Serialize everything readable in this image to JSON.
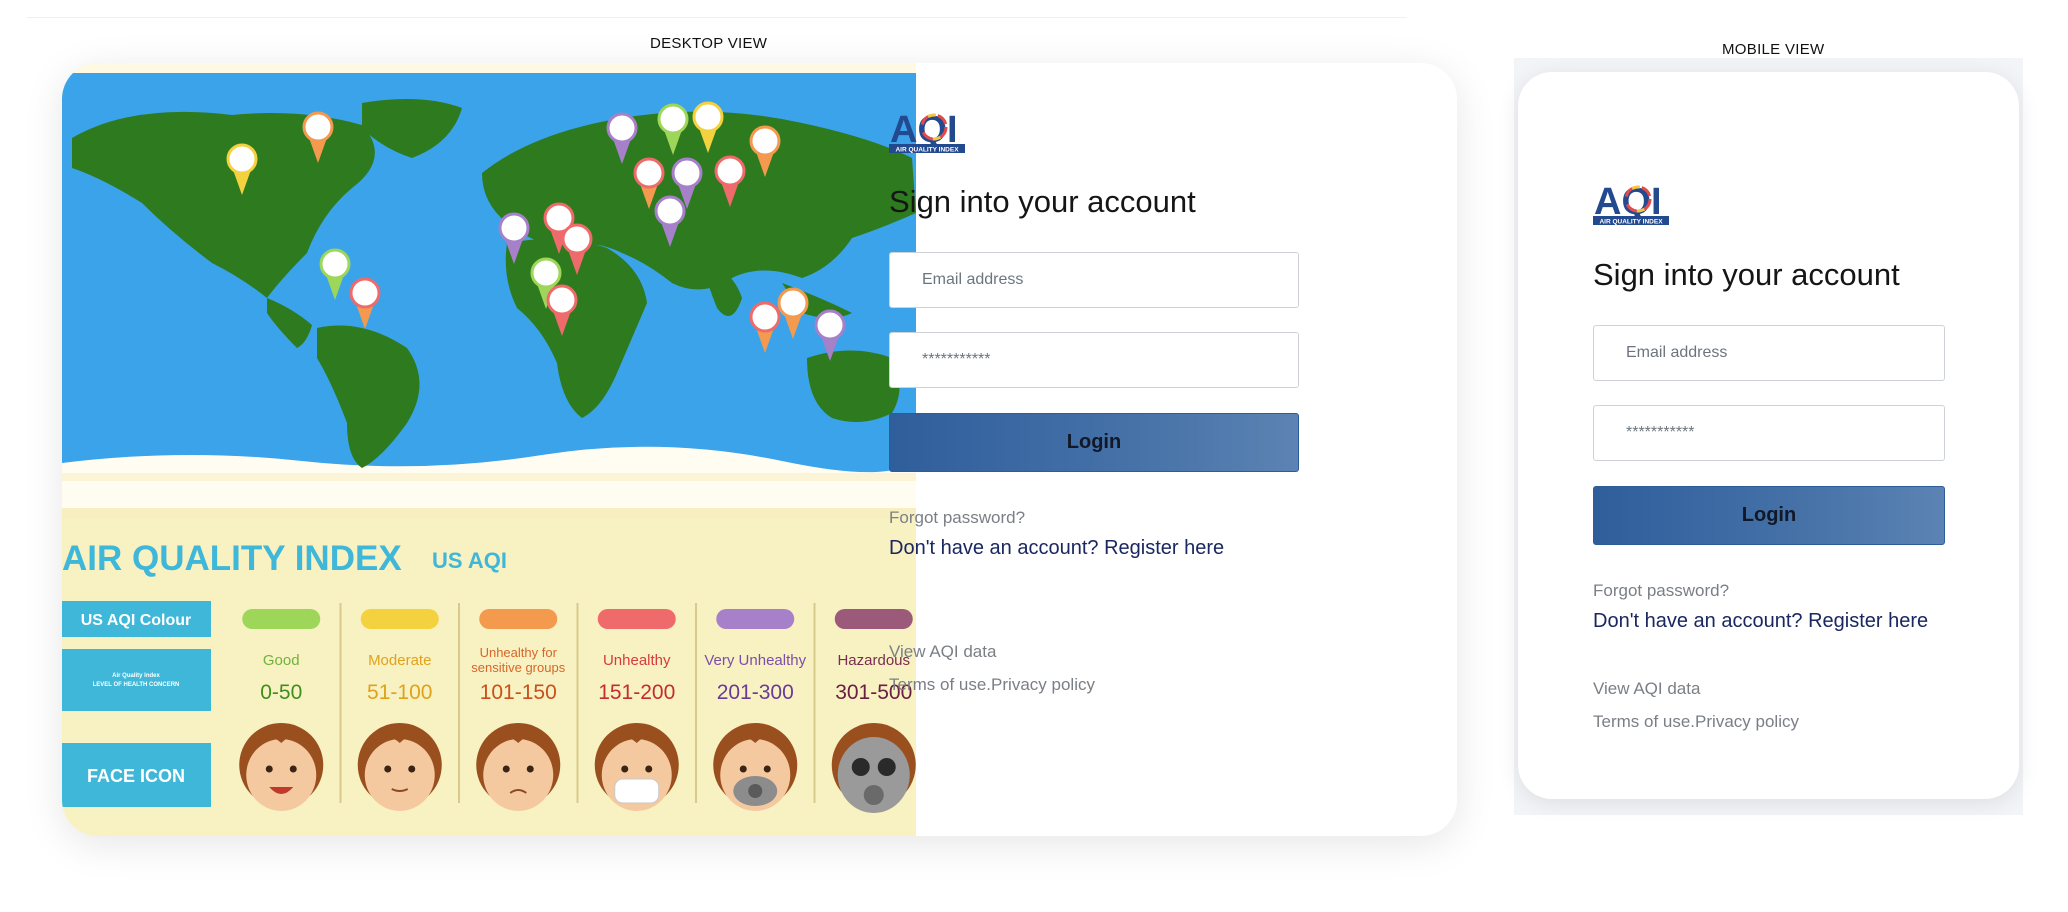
{
  "labels": {
    "desktop": "DESKTOP VIEW",
    "mobile": "MOBILE VIEW"
  },
  "brand": {
    "logo_text": "AQI",
    "logo_sub": "AIR QUALITY INDEX"
  },
  "login": {
    "heading": "Sign into your account",
    "email_placeholder": "Email address",
    "password_placeholder": "***********",
    "login_label": "Login",
    "forgot": "Forgot password?",
    "register": "Don't have an account? Register here",
    "view_data": "View AQI data",
    "terms": "Terms of use.",
    "privacy": "Privacy policy"
  },
  "hero": {
    "title": "AIR QUALITY INDEX",
    "title_suffix": "US AQI",
    "row_colour": "US AQI Colour",
    "row_level_1": "Air Quality Index",
    "row_level_2": "LEVEL OF HEALTH CONCERN",
    "row_face": "FACE ICON",
    "levels": [
      {
        "name": "Good",
        "range": "0-50",
        "color": "#9ed65a",
        "name_color": "#6fb33a",
        "range_color": "#3f8f1d"
      },
      {
        "name": "Moderate",
        "range": "51-100",
        "color": "#f4d23f",
        "name_color": "#e0a21b",
        "range_color": "#e0a21b"
      },
      {
        "name": "Unhealthy for sensitive groups",
        "range": "101-150",
        "color": "#f39a4e",
        "name_color": "#d6662a",
        "range_color": "#c8501c"
      },
      {
        "name": "Unhealthy",
        "range": "151-200",
        "color": "#ef6a6a",
        "name_color": "#d83b3b",
        "range_color": "#c52d2d"
      },
      {
        "name": "Very Unhealthy",
        "range": "201-300",
        "color": "#a680c9",
        "name_color": "#7c4ea8",
        "range_color": "#6a3b96"
      },
      {
        "name": "Hazardous",
        "range": "301-500",
        "color": "#9c5a7a",
        "name_color": "#7a2e50",
        "range_color": "#6a2042"
      }
    ]
  },
  "colors": {
    "accent": "#2f5e9c",
    "register_text": "#1a2760",
    "muted_text": "#7a7f85",
    "hero_bg": "#f7efbf",
    "ocean": "#3aa3ea",
    "land": "#2e7a1f"
  }
}
